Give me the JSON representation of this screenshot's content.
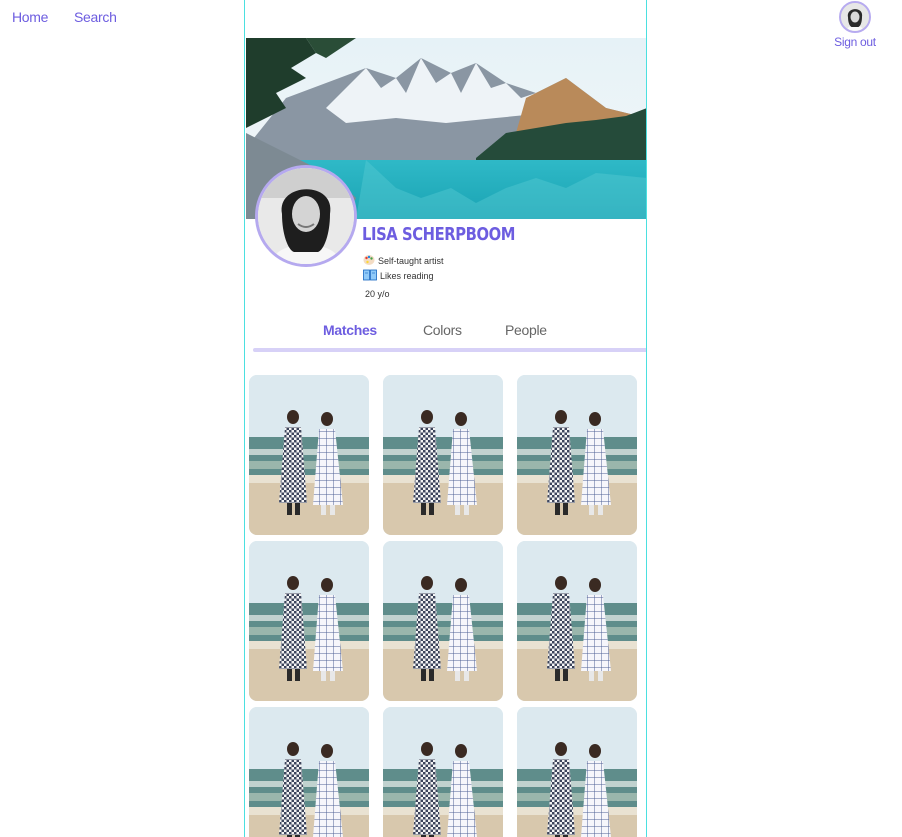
{
  "nav": {
    "home": "Home",
    "search": "Search",
    "sign_out": "Sign out"
  },
  "profile": {
    "name": "LISA SCHERPBOOM",
    "traits": [
      {
        "icon": "palette-icon",
        "text": "Self-taught artist"
      },
      {
        "icon": "book-icon",
        "text": "Likes reading"
      }
    ],
    "age": "20 y/o"
  },
  "tabs": [
    {
      "label": "Matches",
      "active": true
    },
    {
      "label": "Colors",
      "active": false
    },
    {
      "label": "People",
      "active": false
    }
  ],
  "matches": [
    {
      "image": "beach-photo"
    },
    {
      "image": "beach-photo"
    },
    {
      "image": "beach-photo"
    },
    {
      "image": "beach-photo"
    },
    {
      "image": "beach-photo"
    },
    {
      "image": "beach-photo"
    },
    {
      "image": "beach-photo"
    },
    {
      "image": "beach-photo"
    },
    {
      "image": "beach-photo"
    }
  ],
  "colors": {
    "accent": "#6d5de0",
    "column_border": "#4be0e0",
    "tab_underline": "#d7d1f7",
    "avatar_ring": "#b5a9ef"
  }
}
